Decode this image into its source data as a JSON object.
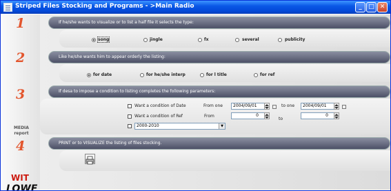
{
  "window": {
    "title": "Striped Files Stocking and Programs - >Main Radio",
    "minimize": "_",
    "maximize": "□",
    "close": "✕"
  },
  "sidebar": {
    "step1": "1",
    "step2": "2",
    "step3": "3",
    "step4": "4",
    "media_line1": "MEDIA",
    "media_line2": "report",
    "brand_line1": "WIT",
    "brand_line2": "LOWE"
  },
  "section1": {
    "header": "If he/she wants to visualize or to list a half file it selects the type:",
    "options": [
      "song",
      "jingle",
      "fx",
      "several",
      "publicity"
    ],
    "selected": "song"
  },
  "section2": {
    "header": "Like he/she wants him to appear orderly the listing:",
    "options": [
      "for date",
      "for he/she interp",
      "for l title",
      "for ref"
    ],
    "selected": "for date"
  },
  "section3": {
    "header": "If desa to impose a condition to listing completes the following parameters:",
    "date_condition": {
      "label": "Want a condition of Date",
      "from_label": "From one",
      "from_value": "2004/09/01",
      "to_label": "to one",
      "to_value": "2004/09/01"
    },
    "ref_condition": {
      "label": "Want a condition of Ref",
      "from_label": "From",
      "from_value": "0",
      "to_label": "to",
      "to_value": "0"
    },
    "range_select": {
      "value": "2000-2010"
    }
  },
  "section4": {
    "header": "PRINT or to VISUALIZE the listing of files stocking."
  },
  "icons": {
    "print": "printer-icon",
    "dropdown": "chevron-down-icon",
    "spin": "spinner-arrows-icon"
  },
  "colors": {
    "titlebar": "#0a58e6",
    "section_header": "#6c7084",
    "step_number": "#e3562e",
    "brand_red": "#cc1a0f"
  }
}
